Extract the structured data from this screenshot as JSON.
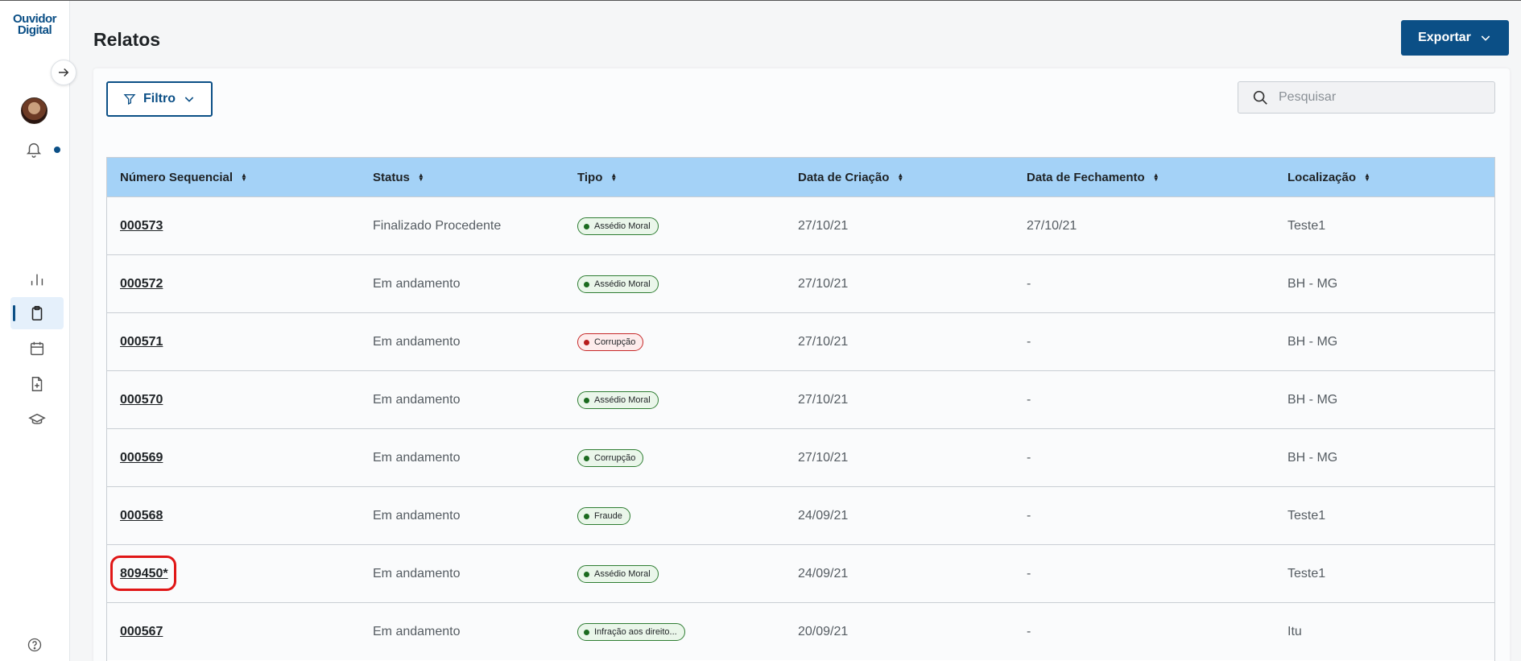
{
  "logo": {
    "line1": "Ouvidor",
    "line2": "Digital"
  },
  "page": {
    "title": "Relatos"
  },
  "export": {
    "label": "Exportar"
  },
  "filter": {
    "label": "Filtro"
  },
  "search": {
    "placeholder": "Pesquisar"
  },
  "table": {
    "headers": [
      "Número Sequencial",
      "Status",
      "Tipo",
      "Data de Criação",
      "Data de Fechamento",
      "Localização"
    ],
    "rows": [
      {
        "seq": "000573",
        "status": "Finalizado Procedente",
        "tipo": "Assédio Moral",
        "tipo_color": "green",
        "criacao": "27/10/21",
        "fechamento": "27/10/21",
        "local": "Teste1"
      },
      {
        "seq": "000572",
        "status": "Em andamento",
        "tipo": "Assédio Moral",
        "tipo_color": "green",
        "criacao": "27/10/21",
        "fechamento": "-",
        "local": "BH - MG"
      },
      {
        "seq": "000571",
        "status": "Em andamento",
        "tipo": "Corrupção",
        "tipo_color": "red",
        "criacao": "27/10/21",
        "fechamento": "-",
        "local": "BH - MG"
      },
      {
        "seq": "000570",
        "status": "Em andamento",
        "tipo": "Assédio Moral",
        "tipo_color": "green",
        "criacao": "27/10/21",
        "fechamento": "-",
        "local": "BH - MG"
      },
      {
        "seq": "000569",
        "status": "Em andamento",
        "tipo": "Corrupção",
        "tipo_color": "green",
        "criacao": "27/10/21",
        "fechamento": "-",
        "local": "BH - MG"
      },
      {
        "seq": "000568",
        "status": "Em andamento",
        "tipo": "Fraude",
        "tipo_color": "green",
        "criacao": "24/09/21",
        "fechamento": "-",
        "local": "Teste1"
      },
      {
        "seq": "809450*",
        "status": "Em andamento",
        "tipo": "Assédio Moral",
        "tipo_color": "green",
        "criacao": "24/09/21",
        "fechamento": "-",
        "local": "Teste1"
      },
      {
        "seq": "000567",
        "status": "Em andamento",
        "tipo": "Infração aos direito...",
        "tipo_color": "green",
        "criacao": "20/09/21",
        "fechamento": "-",
        "local": "Itu"
      }
    ]
  },
  "colors": {
    "primary": "#0b4f86",
    "header_bg": "#a4d2f7",
    "badge_green": "#2e7d32",
    "badge_red": "#c62828",
    "highlight": "#e01616"
  },
  "icons": [
    "arrow-right-icon",
    "bell-icon",
    "bar-chart-icon",
    "clipboard-icon",
    "calendar-icon",
    "file-plus-icon",
    "graduation-cap-icon",
    "help-icon",
    "filter-icon",
    "chevron-down-icon",
    "search-icon",
    "sort-icon"
  ]
}
